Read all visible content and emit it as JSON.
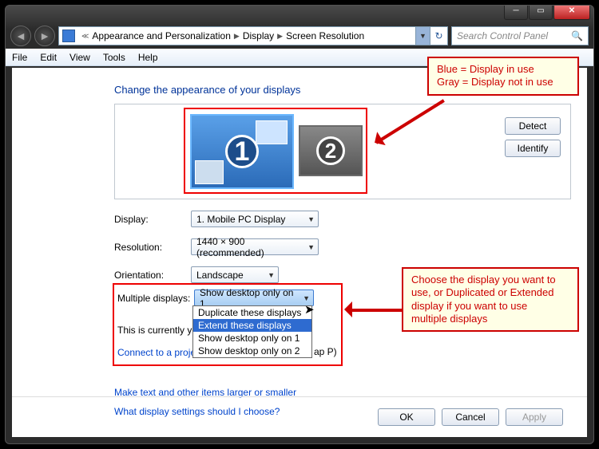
{
  "breadcrumb": {
    "level1": "Appearance and Personalization",
    "level2": "Display",
    "level3": "Screen Resolution"
  },
  "search": {
    "placeholder": "Search Control Panel"
  },
  "menu": {
    "file": "File",
    "edit": "Edit",
    "view": "View",
    "tools": "Tools",
    "help": "Help"
  },
  "heading": "Change the appearance of your displays",
  "monitors": {
    "one": "1",
    "two": "2"
  },
  "buttons": {
    "detect": "Detect",
    "identify": "Identify"
  },
  "form": {
    "display_label": "Display:",
    "display_value": "1. Mobile PC Display",
    "resolution_label": "Resolution:",
    "resolution_value": "1440 × 900 (recommended)",
    "orientation_label": "Orientation:",
    "orientation_value": "Landscape",
    "multi_label": "Multiple displays:",
    "multi_value": "Show desktop only on 1"
  },
  "dropdown": {
    "opt1": "Duplicate these displays",
    "opt2": "Extend these displays",
    "opt3": "Show desktop only on 1",
    "opt4": "Show desktop only on 2"
  },
  "status_text": "This is currently you",
  "projector_link": "Connect to a projec",
  "projector_hint": "ap P)",
  "link1": "Make text and other items larger or smaller",
  "link2": "What display settings should I choose?",
  "footer": {
    "ok": "OK",
    "cancel": "Cancel",
    "apply": "Apply"
  },
  "callout1_line1": "Blue = Display in use",
  "callout1_line2": "Gray = Display not in use",
  "callout2_line1": "Choose the display you want to",
  "callout2_line2": "use, or Duplicated or Extended",
  "callout2_line3": "display if you want to use",
  "callout2_line4": "multiple displays"
}
